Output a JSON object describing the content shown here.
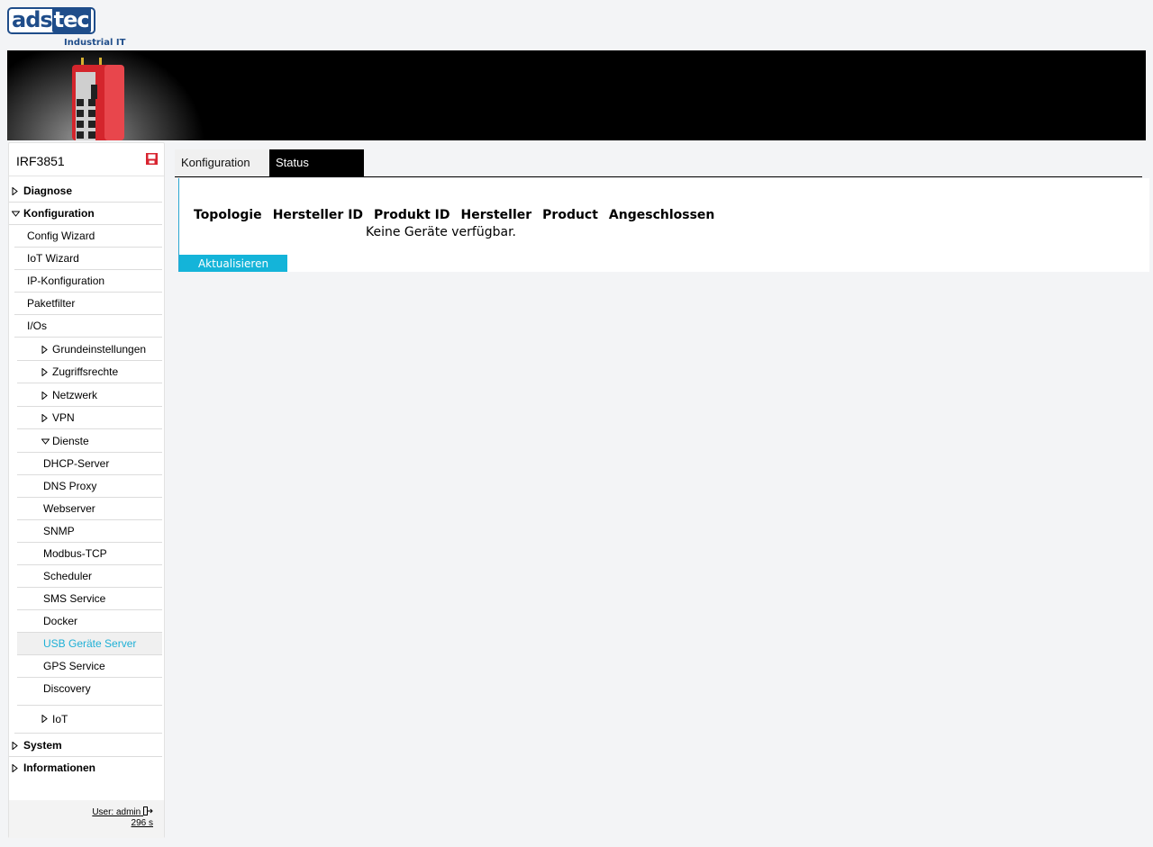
{
  "logo": {
    "mark_left": "ads",
    "mark_right": "tec",
    "subtitle": "Industrial IT"
  },
  "sidebar": {
    "device_name": "IRF3851",
    "items": {
      "diagnose": "Diagnose",
      "konfiguration": "Konfiguration",
      "config_wizard": "Config Wizard",
      "iot_wizard": "IoT Wizard",
      "ip_konfiguration": "IP-Konfiguration",
      "paketfilter": "Paketfilter",
      "ios": "I/Os",
      "grundeinstellungen": "Grundeinstellungen",
      "zugriffsrechte": "Zugriffsrechte",
      "netzwerk": "Netzwerk",
      "vpn": "VPN",
      "dienste": "Dienste",
      "dhcp_server": "DHCP-Server",
      "dns_proxy": "DNS Proxy",
      "webserver": "Webserver",
      "snmp": "SNMP",
      "modbus_tcp": "Modbus-TCP",
      "scheduler": "Scheduler",
      "sms_service": "SMS Service",
      "docker": "Docker",
      "usb_server": "USB Geräte Server",
      "gps_service": "GPS Service",
      "discovery": "Discovery",
      "iot": "IoT",
      "system": "System",
      "informationen": "Informationen"
    },
    "footer": {
      "user": "User: admin",
      "session": "296 s"
    }
  },
  "tabs": {
    "konfiguration": "Konfiguration",
    "status": "Status"
  },
  "table": {
    "headers": [
      "Topologie",
      "Hersteller ID",
      "Produkt ID",
      "Hersteller",
      "Product",
      "Angeschlossen"
    ],
    "empty": "Keine Geräte verfügbar."
  },
  "refresh_label": "Aktualisieren",
  "colors": {
    "accent": "#14b4d9",
    "brand": "#1f4d8a",
    "device_red": "#e0262e"
  }
}
